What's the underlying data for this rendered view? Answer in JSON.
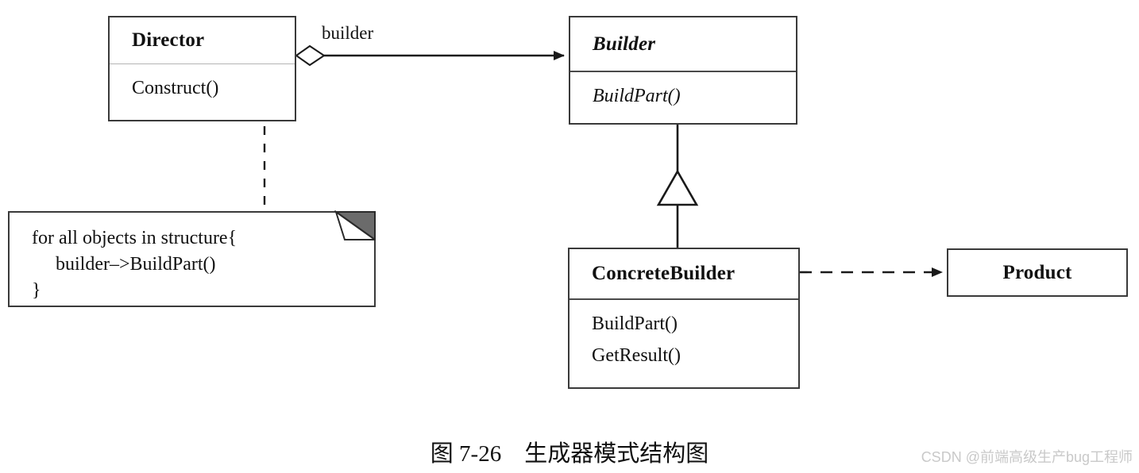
{
  "diagram": {
    "classes": {
      "director": {
        "name": "Director",
        "operations": [
          "Construct()"
        ]
      },
      "builder": {
        "name": "Builder",
        "operations": [
          "BuildPart()"
        ]
      },
      "concrete_builder": {
        "name": "ConcreteBuilder",
        "operations": [
          "BuildPart()",
          "GetResult()"
        ]
      },
      "product": {
        "name": "Product",
        "operations": []
      }
    },
    "note": {
      "lines": [
        "for all objects in structure{",
        "     builder–>BuildPart()",
        "}"
      ]
    },
    "edges": {
      "aggregation_label": "builder"
    }
  },
  "caption": "图 7-26　生成器模式结构图",
  "watermark": "CSDN @前端高级生产bug工程师",
  "colors": {
    "stroke": "#3a3a3a",
    "fold_fill": "#6b6b6b",
    "background": "#ffffff",
    "watermark": "#c9c9c9"
  }
}
